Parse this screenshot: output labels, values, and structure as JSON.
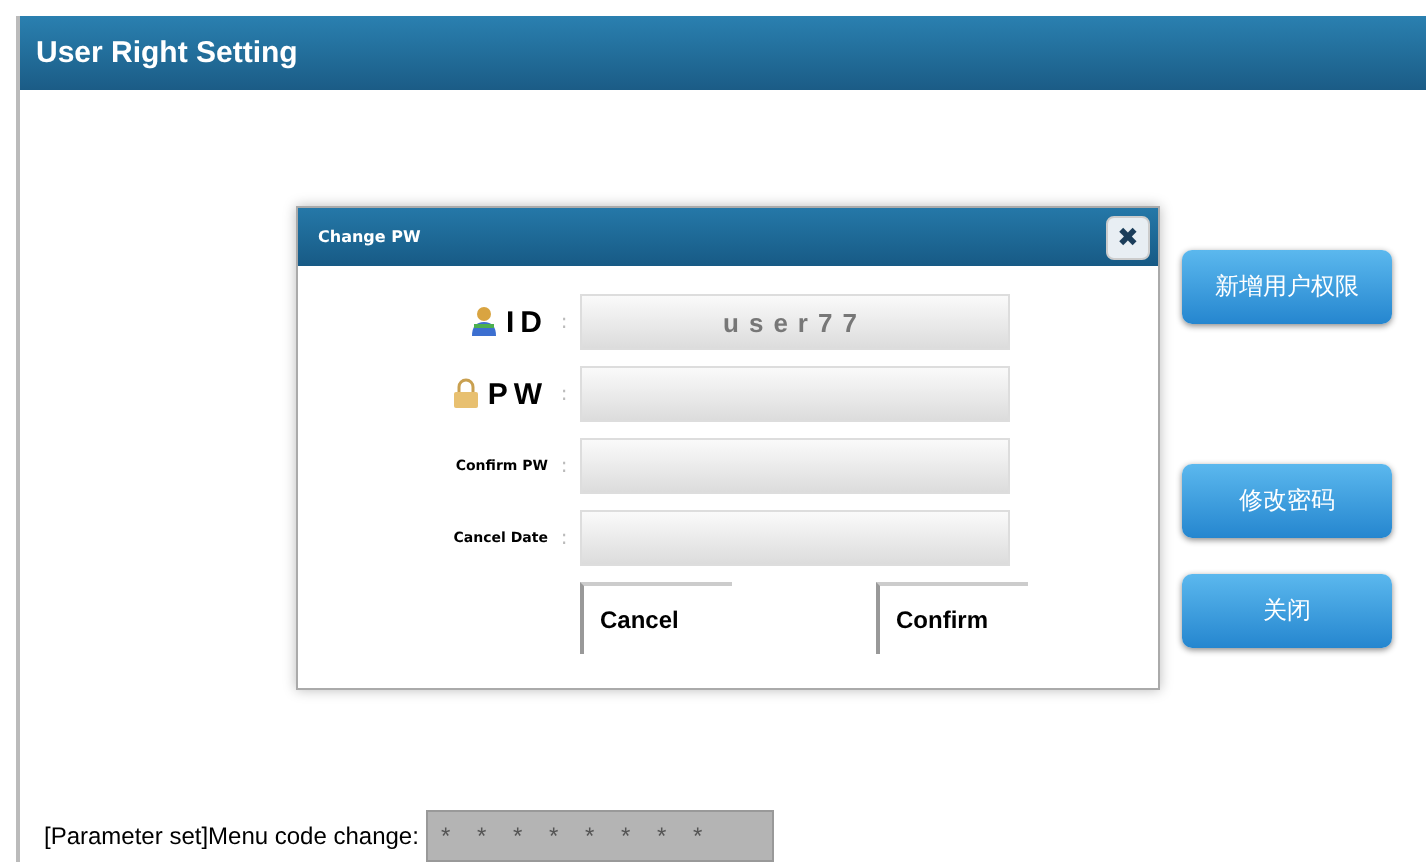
{
  "window": {
    "title": "User Right Setting"
  },
  "dialog": {
    "title": "Change PW",
    "close_label": "✖",
    "fields": [
      {
        "kind": "id",
        "label": "ID",
        "separator": ":",
        "value": "user77"
      },
      {
        "kind": "pw",
        "label": "PW",
        "separator": ":"
      },
      {
        "kind": "plain",
        "label": "Confirm PW",
        "separator": ":"
      },
      {
        "kind": "plain",
        "label": "Cancel Date",
        "separator": ":"
      }
    ],
    "buttons": [
      "Cancel",
      "Confirm"
    ]
  },
  "side_buttons": [
    "新增用户权限",
    "修改密码",
    "关闭"
  ],
  "menu_code": {
    "label": "[Parameter set]Menu code change:",
    "value": "* * * * * * * *"
  }
}
